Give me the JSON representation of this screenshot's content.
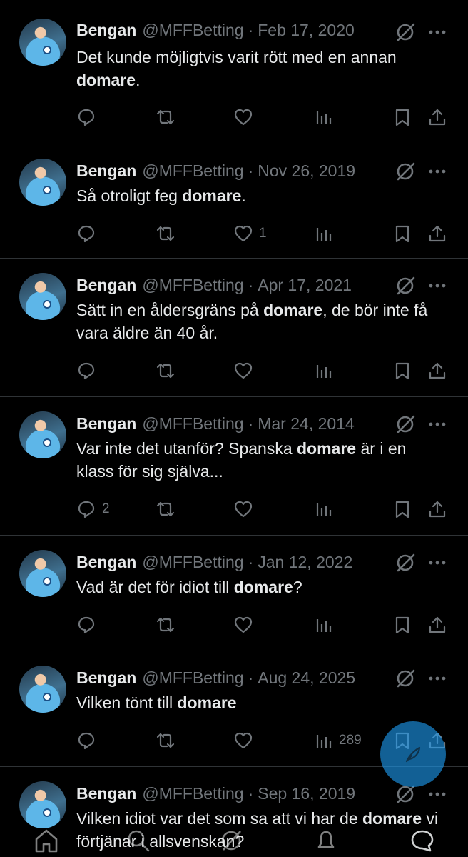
{
  "accent_color": "#1d9bf0",
  "tweets": [
    {
      "name": "Bengan",
      "handle": "@MFFBetting",
      "separator": "·",
      "date": "Feb 17, 2020",
      "text_before": "Det kunde möjligtvis varit rött med en annan ",
      "highlight": "domare",
      "text_after": ".",
      "reply_count": "",
      "like_count": "",
      "views_count": ""
    },
    {
      "name": "Bengan",
      "handle": "@MFFBetting",
      "separator": "·",
      "date": "Nov 26, 2019",
      "text_before": "Så otroligt feg ",
      "highlight": "domare",
      "text_after": ".",
      "reply_count": "",
      "like_count": "1",
      "views_count": ""
    },
    {
      "name": "Bengan",
      "handle": "@MFFBetting",
      "separator": "·",
      "date": "Apr 17, 2021",
      "text_before": "Sätt in en åldersgräns på ",
      "highlight": "domare",
      "text_after": ", de bör inte få vara äldre än 40 år.",
      "reply_count": "",
      "like_count": "",
      "views_count": ""
    },
    {
      "name": "Bengan",
      "handle": "@MFFBetting",
      "separator": "·",
      "date": "Mar 24, 2014",
      "text_before": "Var inte det utanför? Spanska ",
      "highlight": "domare",
      "text_after": " är i en klass för sig själva...",
      "reply_count": "2",
      "like_count": "",
      "views_count": ""
    },
    {
      "name": "Bengan",
      "handle": "@MFFBetting",
      "separator": "·",
      "date": "Jan 12, 2022",
      "text_before": "Vad är det för idiot till ",
      "highlight": "domare",
      "text_after": "?",
      "reply_count": "",
      "like_count": "",
      "views_count": ""
    },
    {
      "name": "Bengan",
      "handle": "@MFFBetting",
      "separator": "·",
      "date": "Aug 24, 2025",
      "text_before": "Vilken tönt till ",
      "highlight": "domare",
      "text_after": "",
      "reply_count": "",
      "like_count": "",
      "views_count": "289"
    },
    {
      "name": "Bengan",
      "handle": "@MFFBetting",
      "separator": "·",
      "date": "Sep 16, 2019",
      "text_before": "Vilken idiot var det som sa att vi har de ",
      "highlight": "domare",
      "text_after": " vi förtjänar i allsvenskan?",
      "reply_count": "",
      "like_count": "",
      "views_count": ""
    }
  ],
  "icons": {
    "reply": "reply-icon",
    "repost": "repost-icon",
    "like": "like-icon",
    "views": "views-icon",
    "bookmark": "bookmark-icon",
    "share": "share-icon",
    "grok": "grok-icon",
    "more": "more-icon",
    "compose": "compose-icon",
    "home": "home-icon",
    "search": "search-icon",
    "communities": "communities-icon",
    "notifications": "notifications-icon",
    "messages": "messages-icon"
  }
}
